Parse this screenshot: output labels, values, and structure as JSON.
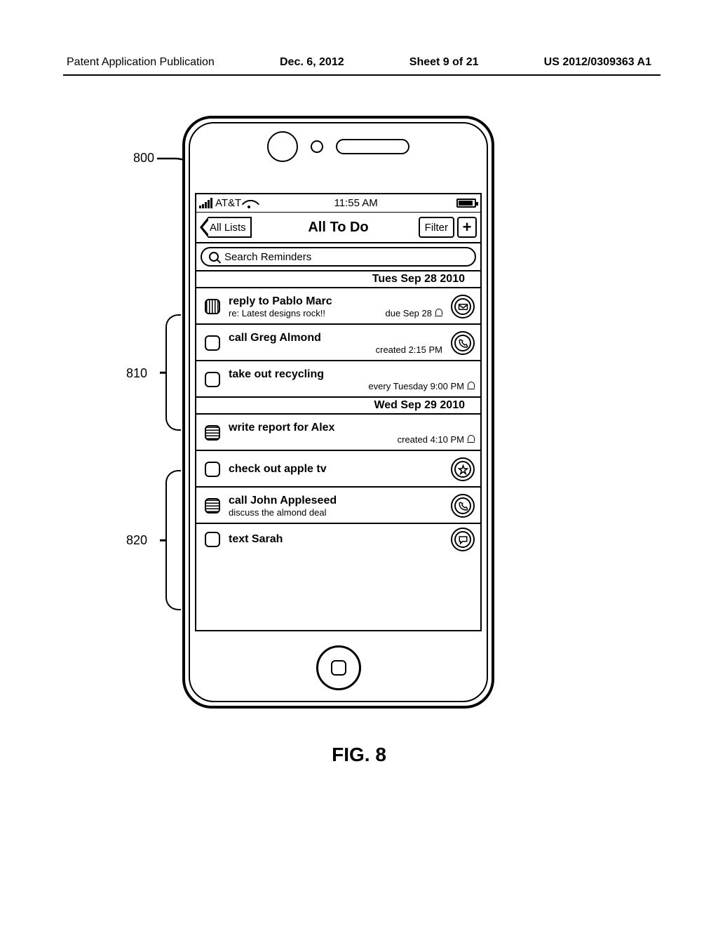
{
  "publication": {
    "outlet": "Patent Application Publication",
    "date": "Dec. 6, 2012",
    "sheet": "Sheet 9 of 21",
    "pubno": "US 2012/0309363 A1"
  },
  "figure": {
    "label": "FIG. 8"
  },
  "callouts": {
    "c800": "800",
    "c810": "810",
    "c820": "820"
  },
  "status": {
    "carrier": "AT&T",
    "time": "11:55 AM"
  },
  "nav": {
    "back": "All Lists",
    "title": "All To Do",
    "filter": "Filter"
  },
  "search": {
    "placeholder": "Search Reminders"
  },
  "sections": [
    {
      "header": "Tues Sep 28 2010",
      "items": [
        {
          "title": "reply to Pablo Marc",
          "sub_left": "re: Latest designs rock!!",
          "sub_right": "due Sep 28",
          "checkbox": "hatch",
          "action": "mail",
          "bell": true
        },
        {
          "title": "call Greg Almond",
          "sub_left": "",
          "sub_right": "created 2:15 PM",
          "checkbox": "plain",
          "action": "phone",
          "bell": false
        },
        {
          "title": "take out recycling",
          "sub_left": "",
          "sub_right": "every Tuesday 9:00 PM",
          "checkbox": "plain",
          "action": "",
          "bell": true
        }
      ]
    },
    {
      "header": "Wed Sep 29 2010",
      "items": [
        {
          "title": "write report for Alex",
          "sub_left": "",
          "sub_right": "created 4:10 PM",
          "checkbox": "lines",
          "action": "",
          "bell": true
        },
        {
          "title": "check out apple tv",
          "sub_left": "",
          "sub_right": "",
          "checkbox": "plain",
          "action": "star",
          "bell": false
        },
        {
          "title": "call John Appleseed",
          "sub_left": "discuss the almond deal",
          "sub_right": "",
          "checkbox": "lines",
          "action": "phone",
          "bell": false
        },
        {
          "title": "text Sarah",
          "sub_left": "",
          "sub_right": "",
          "checkbox": "plain",
          "action": "chat",
          "bell": false,
          "short": true
        }
      ]
    }
  ]
}
